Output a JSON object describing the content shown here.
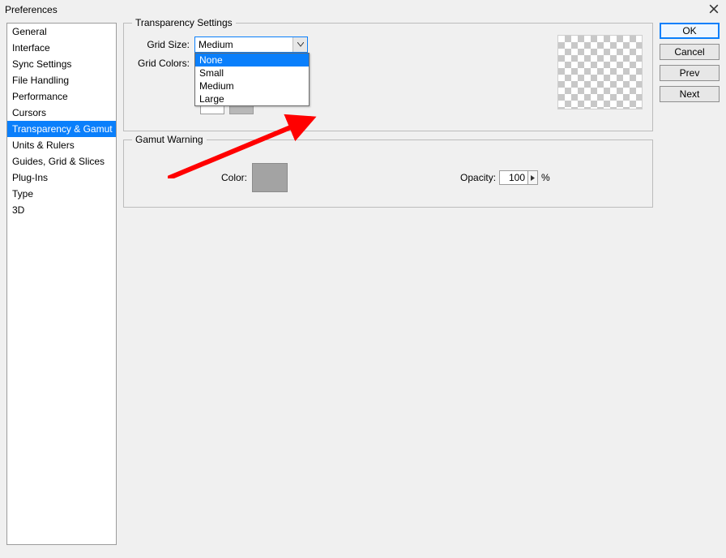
{
  "window": {
    "title": "Preferences"
  },
  "sidebar": {
    "items": [
      {
        "label": "General"
      },
      {
        "label": "Interface"
      },
      {
        "label": "Sync Settings"
      },
      {
        "label": "File Handling"
      },
      {
        "label": "Performance"
      },
      {
        "label": "Cursors"
      },
      {
        "label": "Transparency & Gamut"
      },
      {
        "label": "Units & Rulers"
      },
      {
        "label": "Guides, Grid & Slices"
      },
      {
        "label": "Plug-Ins"
      },
      {
        "label": "Type"
      },
      {
        "label": "3D"
      }
    ],
    "selected_index": 6
  },
  "transparency": {
    "legend": "Transparency Settings",
    "grid_size_label": "Grid Size:",
    "grid_size_value": "Medium",
    "grid_size_options": [
      "None",
      "Small",
      "Medium",
      "Large"
    ],
    "grid_size_highlight_index": 0,
    "grid_colors_label": "Grid Colors:"
  },
  "gamut": {
    "legend": "Gamut Warning",
    "color_label": "Color:",
    "color_value": "#a3a3a3",
    "opacity_label": "Opacity:",
    "opacity_value": "100",
    "opacity_unit": "%"
  },
  "buttons": {
    "ok": "OK",
    "cancel": "Cancel",
    "prev": "Prev",
    "next": "Next"
  },
  "annotation": {
    "type": "arrow",
    "color": "#ff0000",
    "points_to": "grid_size_option_none"
  }
}
